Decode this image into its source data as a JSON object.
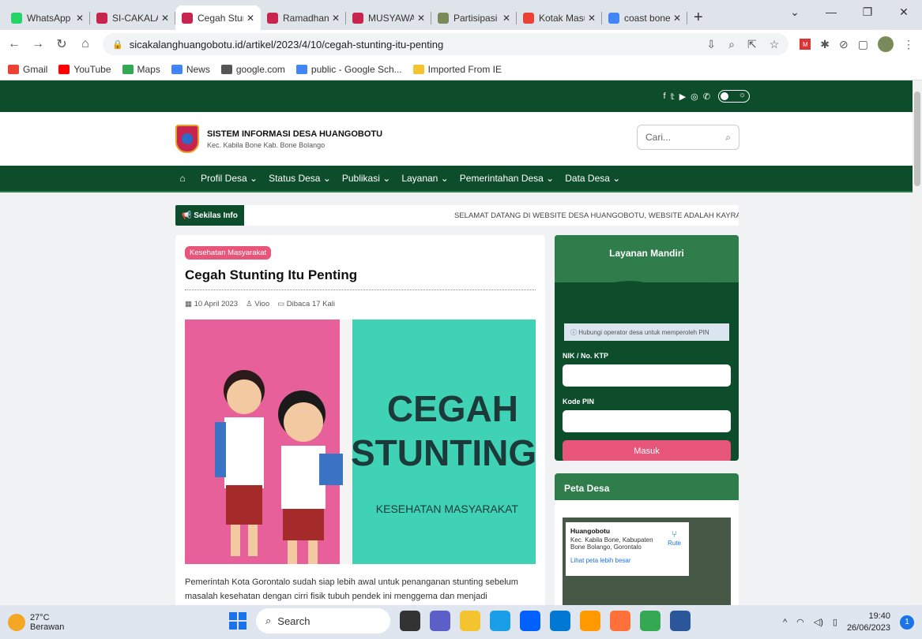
{
  "browser": {
    "tabs": [
      {
        "title": "WhatsApp",
        "color": "#25d366"
      },
      {
        "title": "SI-CAKALANG",
        "color": "#c7254e"
      },
      {
        "title": "Cegah Stunting",
        "color": "#c7254e",
        "active": true
      },
      {
        "title": "Ramadhan Be",
        "color": "#c7254e"
      },
      {
        "title": "MUSYAWARA",
        "color": "#c7254e"
      },
      {
        "title": "Partisipasi Po",
        "color": "#7a8b5a"
      },
      {
        "title": "Kotak Masuk",
        "color": "#ea4335"
      },
      {
        "title": "coast bone ar",
        "color": "#4285f4"
      }
    ],
    "new_tab": "+",
    "url": "sicakalanghuangobotu.id/artikel/2023/4/10/cegah-stunting-itu-penting",
    "bookmarks": [
      {
        "label": "Gmail",
        "color": "#ea4335"
      },
      {
        "label": "YouTube",
        "color": "#ff0000"
      },
      {
        "label": "Maps",
        "color": "#34a853"
      },
      {
        "label": "News",
        "color": "#4285f4"
      },
      {
        "label": "google.com",
        "color": "#555555"
      },
      {
        "label": "public - Google Sch...",
        "color": "#4285f4"
      },
      {
        "label": "Imported From IE",
        "color": "#f4c430"
      }
    ]
  },
  "site": {
    "name": "SISTEM INFORMASI DESA HUANGOBOTU",
    "subtitle": "Kec. Kabila Bone Kab. Bone Bolango",
    "search_placeholder": "Cari...",
    "menu": [
      "Profil Desa",
      "Status Desa",
      "Publikasi",
      "Layanan",
      "Pemerintahan Desa",
      "Data Desa"
    ],
    "sekilas_label": "Sekilas Info",
    "sekilas_text": "SELAMAT DATANG DI WEBSITE DESA HUANGOBOTU, WEBSITE ADALAH KAYRA MAHASISW"
  },
  "article": {
    "category": "Kesehatan Masyarakat",
    "title": "Cegah Stunting Itu Penting",
    "date": "10 April 2023",
    "author": "Vioo",
    "views": "Dibaca 17 Kali",
    "hero_line1": "CEGAH",
    "hero_line2": "STUNTING",
    "hero_line3": "KESEHATAN MASYARAKAT",
    "body": "Pemerintah Kota Gorontalo sudah siap lebih awal untuk penanganan stunting sebelum masalah kesehatan dengan cirri fisik tubuh pendek ini menggema dan menjadi problematika nasional. Upaya"
  },
  "layanan": {
    "title": "Layanan Mandiri",
    "note": "Hubungi operator desa untuk memperoleh PIN",
    "nik_label": "NIK / No. KTP",
    "pin_label": "Kode PIN",
    "button": "Masuk"
  },
  "peta": {
    "title": "Peta Desa",
    "place": "Huangobotu",
    "address": "Kec. Kabila Bone, Kabupaten Bone Bolango, Gorontalo",
    "route": "Rute",
    "link": "Lihat peta lebih besar"
  },
  "taskbar": {
    "temp": "27°C",
    "weather": "Berawan",
    "search": "Search",
    "time": "19:40",
    "date": "26/06/2023",
    "notifications": "1"
  }
}
